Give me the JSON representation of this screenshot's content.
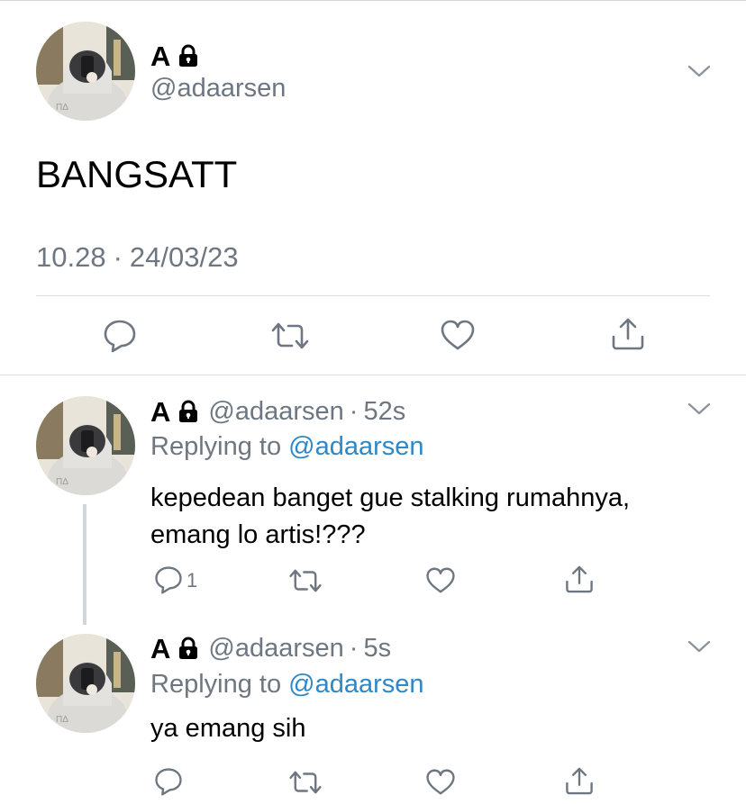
{
  "main_tweet": {
    "name": "A",
    "handle": "@adaarsen",
    "text": "BANGSATT",
    "time": "10.28",
    "separator": "·",
    "date": "24/03/23"
  },
  "replies": [
    {
      "name": "A",
      "handle": "@adaarsen",
      "dot": "·",
      "age": "52s",
      "replying_prefix": "Replying to",
      "replying_to": "@adaarsen",
      "text_line1": "kepedean banget gue stalking rumahnya,",
      "text_line2": "emang lo artis!???",
      "reply_count": "1"
    },
    {
      "name": "A",
      "handle": "@adaarsen",
      "dot": "·",
      "age": "5s",
      "replying_prefix": "Replying to",
      "replying_to": "@adaarsen",
      "text_line1": "ya emang sih",
      "reply_count": ""
    }
  ],
  "icons": [
    "lock-icon",
    "chevron-down-icon",
    "reply-icon",
    "retweet-icon",
    "like-icon",
    "share-icon"
  ],
  "colors": {
    "link": "#2e88c8",
    "secondary_text": "#6e7781",
    "icon": "#6e7781",
    "divider": "#dcdcdc"
  }
}
